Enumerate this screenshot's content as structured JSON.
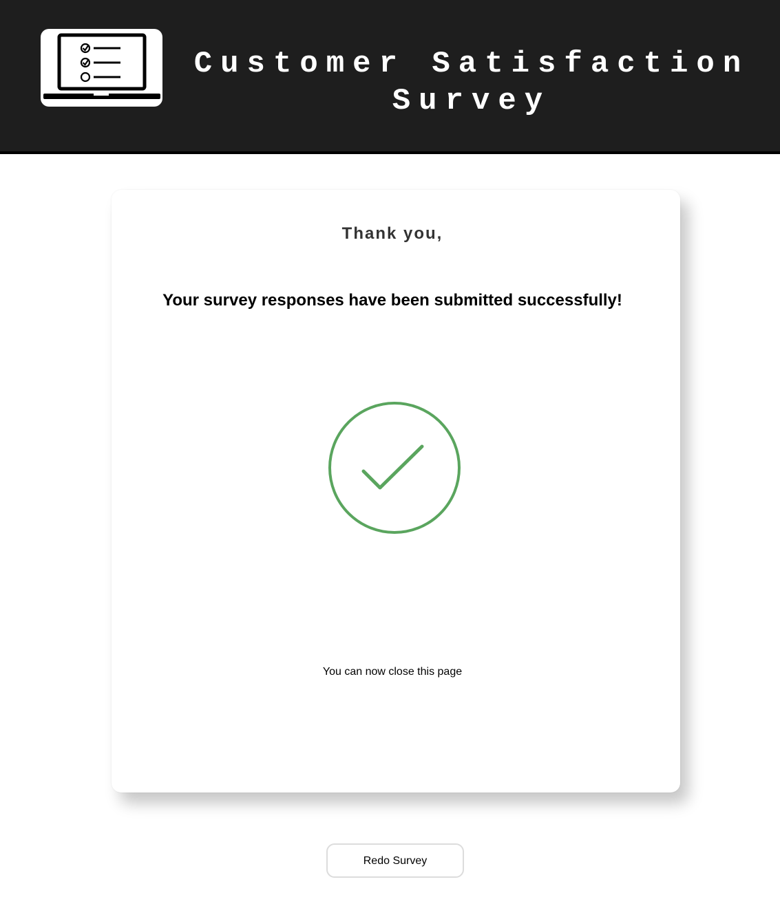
{
  "header": {
    "title_line1": "Customer Satisfaction",
    "title_line2": "Survey",
    "logo_icon": "laptop-checklist-icon"
  },
  "card": {
    "thanks_text": "Thank you,",
    "message_text": "Your survey responses have been submitted successfully!",
    "success_icon": "check-circle-icon",
    "close_note": "You can now close this page"
  },
  "actions": {
    "redo_label": "Redo Survey"
  },
  "colors": {
    "header_bg": "#1e1e1e",
    "success_green": "#5aa55e",
    "title_text": "#ffffff"
  }
}
